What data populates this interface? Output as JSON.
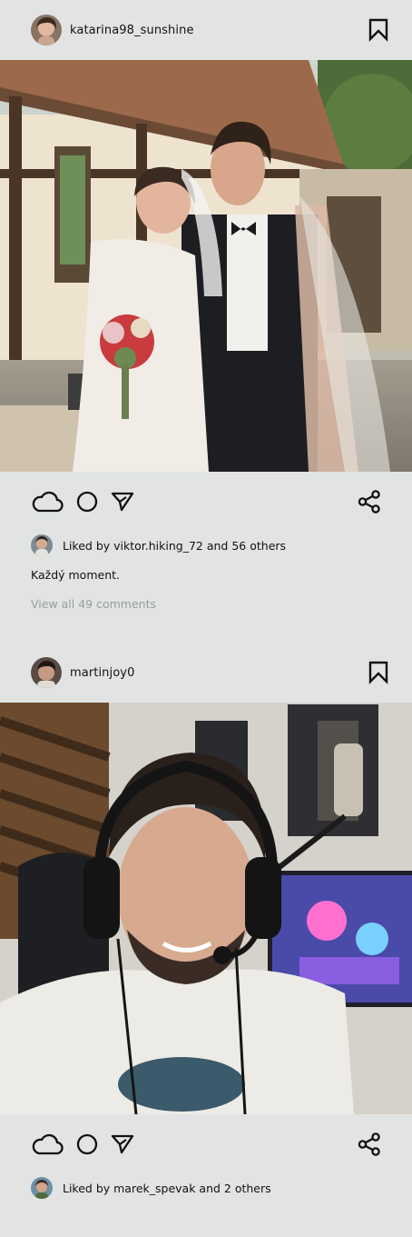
{
  "posts": [
    {
      "username": "katarina98_sunshine",
      "likes_text": "Liked by viktor.hiking_72 and 56 others",
      "caption": "Každý moment.",
      "comments_link": "View all 49 comments"
    },
    {
      "username": "martinjoy0",
      "likes_text": "Liked by marek_spevak and 2 others"
    }
  ],
  "icons": {
    "bookmark": "bookmark-icon",
    "like": "cloud-icon",
    "comment": "circle-icon",
    "send": "send-icon",
    "share": "share-icon"
  },
  "colors": {
    "background": "#e1e4e3",
    "text": "#111111",
    "muted": "#9a9d9e"
  }
}
